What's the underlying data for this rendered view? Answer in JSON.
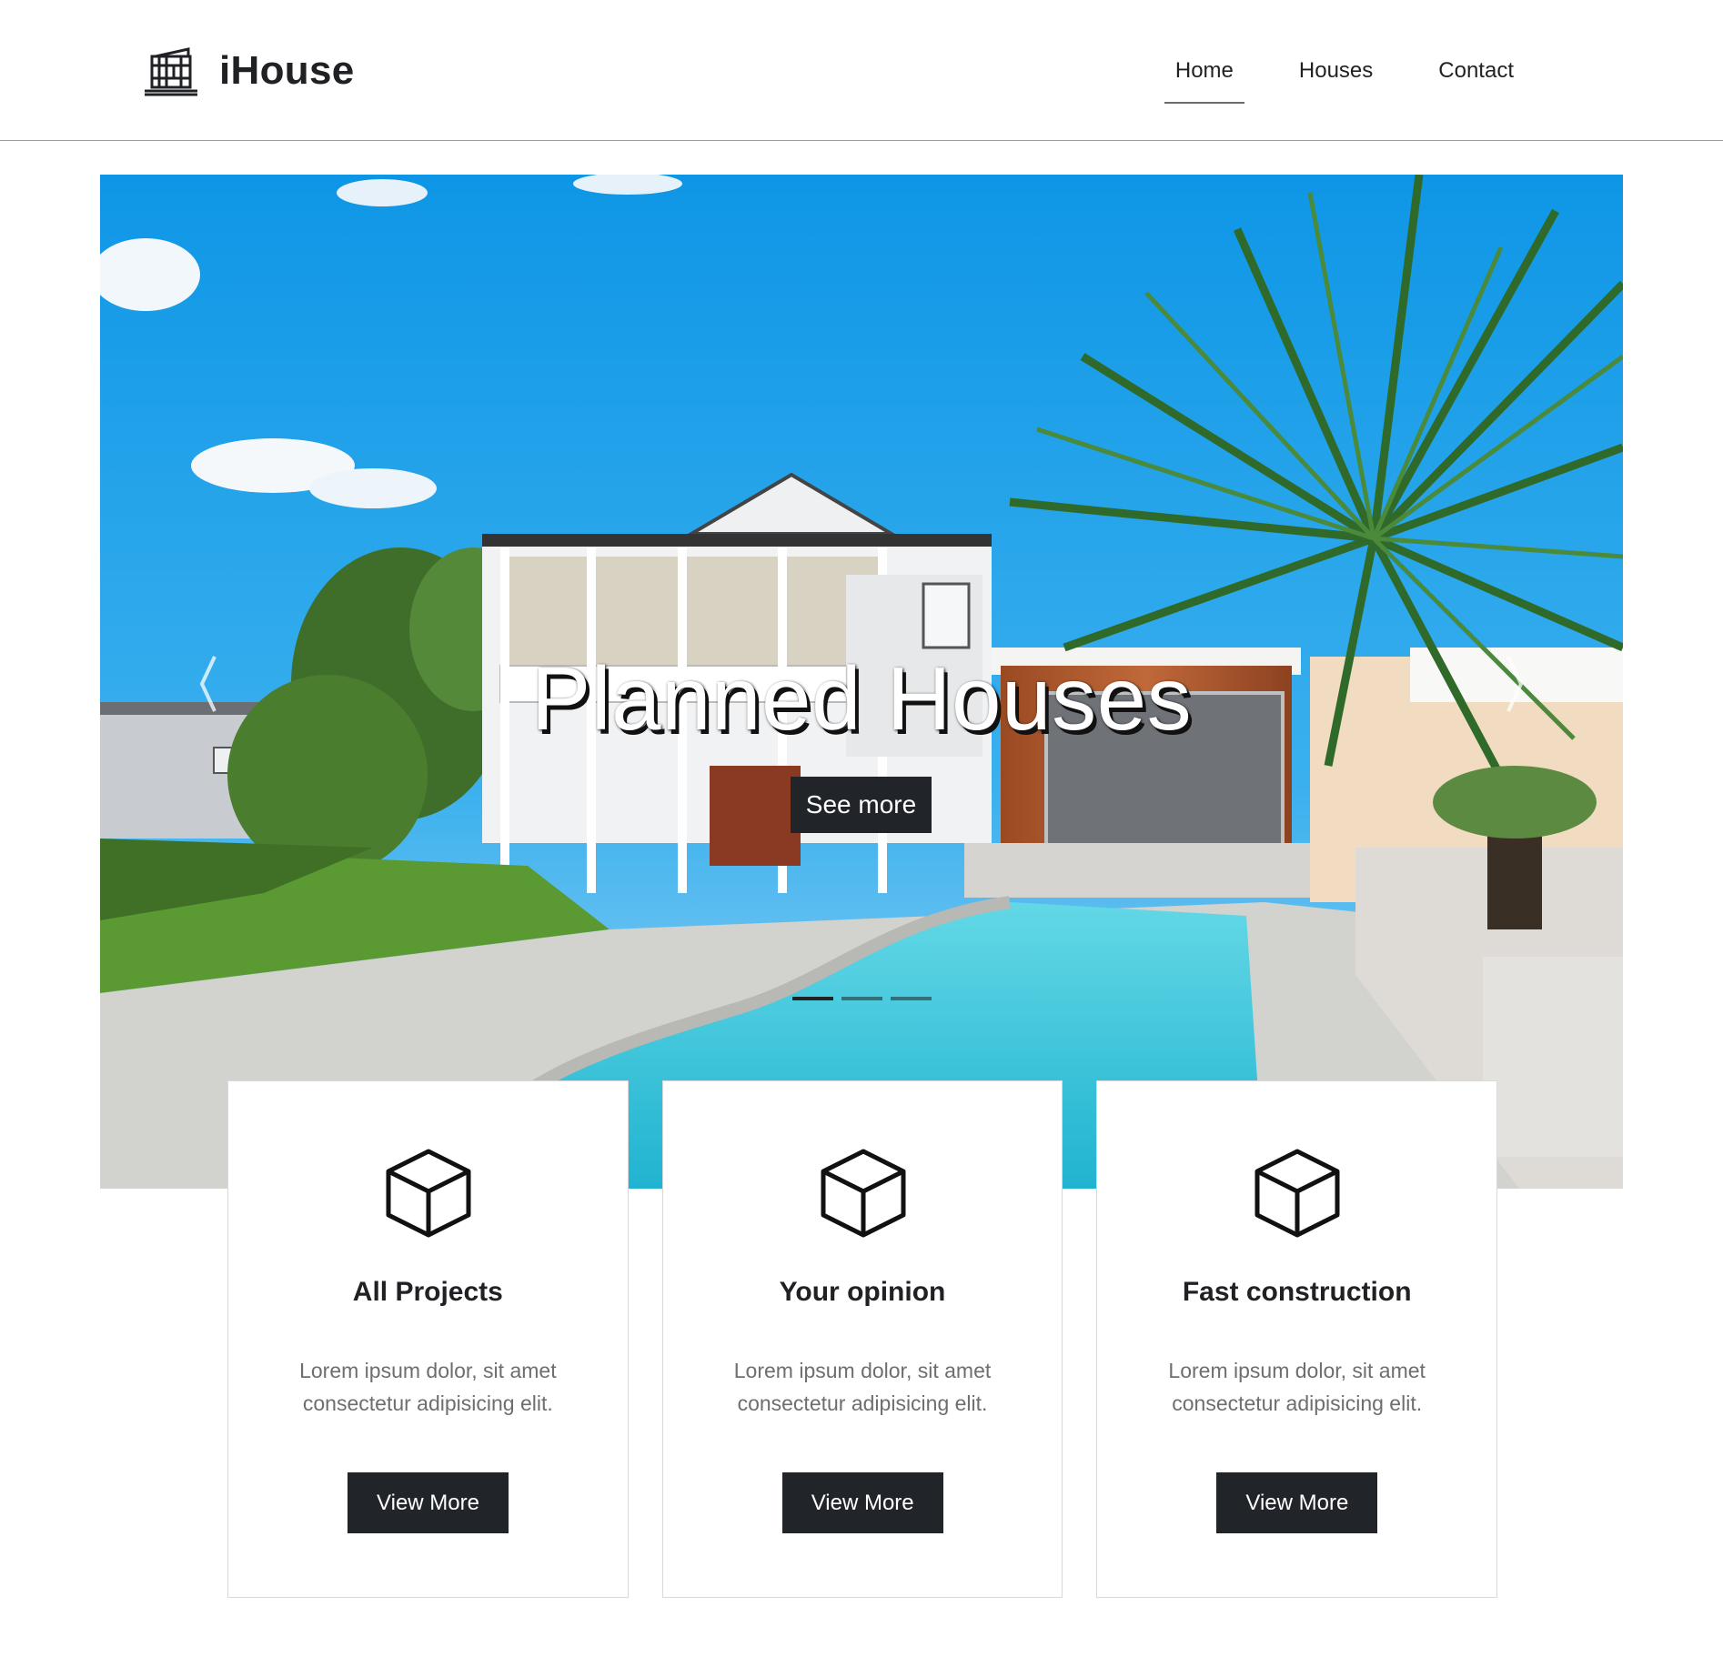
{
  "header": {
    "brand_name": "iHouse",
    "brand_icon": "house-logo-icon",
    "nav": [
      {
        "label": "Home",
        "active": true
      },
      {
        "label": "Houses",
        "active": false
      },
      {
        "label": "Contact",
        "active": false
      }
    ]
  },
  "hero": {
    "title": "Planned Houses",
    "button_label": "See more",
    "prev_icon": "chevron-left-icon",
    "next_icon": "chevron-right-icon",
    "slides_count": 3,
    "active_slide": 1
  },
  "cards": [
    {
      "icon": "cube-icon",
      "title": "All Projects",
      "text": "Lorem ipsum dolor, sit amet consectetur adipisicing elit.",
      "button_label": "View More"
    },
    {
      "icon": "cube-icon",
      "title": "Your opinion",
      "text": "Lorem ipsum dolor, sit amet consectetur adipisicing elit.",
      "button_label": "View More"
    },
    {
      "icon": "cube-icon",
      "title": "Fast construction",
      "text": "Lorem ipsum dolor, sit amet consectetur adipisicing elit.",
      "button_label": "View More"
    }
  ],
  "colors": {
    "dark": "#212529",
    "sky": "#1aa3ea",
    "pool": "#3cc6da"
  }
}
